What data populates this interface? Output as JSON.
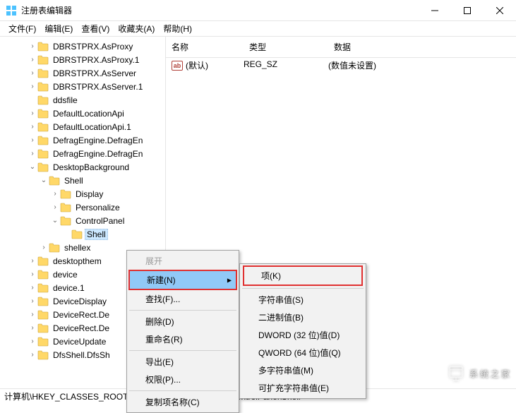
{
  "title": "注册表编辑器",
  "menus": {
    "file": "文件(F)",
    "edit": "编辑(E)",
    "view": "查看(V)",
    "fav": "收藏夹(A)",
    "help": "帮助(H)"
  },
  "list": {
    "headers": {
      "name": "名称",
      "type": "类型",
      "data": "数据"
    },
    "row": {
      "name": "(默认)",
      "type": "REG_SZ",
      "data": "(数值未设置)"
    }
  },
  "tree": [
    {
      "indent": 2,
      "expander": ">",
      "label": "DBRSTPRX.AsProxy"
    },
    {
      "indent": 2,
      "expander": ">",
      "label": "DBRSTPRX.AsProxy.1"
    },
    {
      "indent": 2,
      "expander": ">",
      "label": "DBRSTPRX.AsServer"
    },
    {
      "indent": 2,
      "expander": ">",
      "label": "DBRSTPRX.AsServer.1"
    },
    {
      "indent": 2,
      "expander": "",
      "label": "ddsfile"
    },
    {
      "indent": 2,
      "expander": ">",
      "label": "DefaultLocationApi"
    },
    {
      "indent": 2,
      "expander": ">",
      "label": "DefaultLocationApi.1"
    },
    {
      "indent": 2,
      "expander": ">",
      "label": "DefragEngine.DefragEn"
    },
    {
      "indent": 2,
      "expander": ">",
      "label": "DefragEngine.DefragEn"
    },
    {
      "indent": 2,
      "expander": "v",
      "label": "DesktopBackground"
    },
    {
      "indent": 3,
      "expander": "v",
      "label": "Shell"
    },
    {
      "indent": 4,
      "expander": ">",
      "label": "Display"
    },
    {
      "indent": 4,
      "expander": ">",
      "label": "Personalize"
    },
    {
      "indent": 4,
      "expander": "v",
      "label": "ControlPanel"
    },
    {
      "indent": 5,
      "expander": "",
      "label": "Shell",
      "selected": true
    },
    {
      "indent": 3,
      "expander": ">",
      "label": "shellex"
    },
    {
      "indent": 2,
      "expander": ">",
      "label": "desktopthem"
    },
    {
      "indent": 2,
      "expander": ">",
      "label": "device"
    },
    {
      "indent": 2,
      "expander": ">",
      "label": "device.1"
    },
    {
      "indent": 2,
      "expander": ">",
      "label": "DeviceDisplay"
    },
    {
      "indent": 2,
      "expander": ">",
      "label": "DeviceRect.De"
    },
    {
      "indent": 2,
      "expander": ">",
      "label": "DeviceRect.De"
    },
    {
      "indent": 2,
      "expander": ">",
      "label": "DeviceUpdate"
    },
    {
      "indent": 2,
      "expander": ">",
      "label": "DfsShell.DfsSh"
    }
  ],
  "ctx1": {
    "expand": "展开",
    "new": "新建(N)",
    "find": "查找(F)...",
    "delete": "删除(D)",
    "rename": "重命名(R)",
    "export": "导出(E)",
    "perm": "权限(P)...",
    "copykey": "复制项名称(C)"
  },
  "ctx2": {
    "key": "项(K)",
    "string": "字符串值(S)",
    "binary": "二进制值(B)",
    "dword": "DWORD (32 位)值(D)",
    "qword": "QWORD (64 位)值(Q)",
    "multi": "多字符串值(M)",
    "expand": "可扩充字符串值(E)"
  },
  "status": "计算机\\HKEY_CLASSES_ROOT\\DesktopBackground\\Shell\\ControlPanel\\Shell",
  "watermark": "系统之家"
}
